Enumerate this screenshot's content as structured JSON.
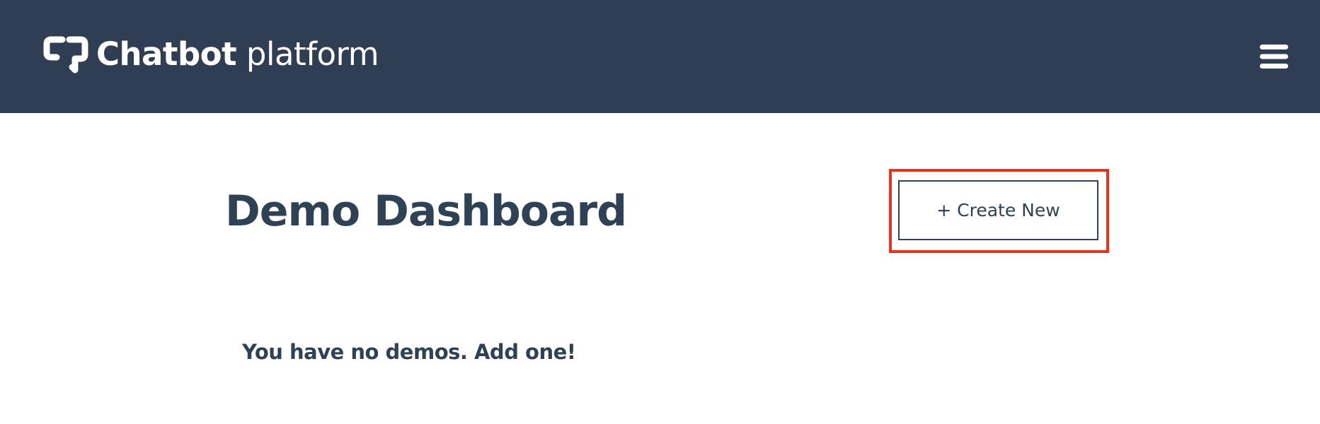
{
  "header": {
    "brand_bold": "Chatbot",
    "brand_light": "platform",
    "logo_icon": "chat-bubble-logo-icon",
    "menu_icon": "hamburger-menu-icon",
    "background_color": "#2f3e52"
  },
  "main": {
    "title": "Demo Dashboard",
    "create_button_label": "+ Create New",
    "empty_message": "You have no demos. Add one!",
    "text_color": "#2f4155",
    "highlight_color": "#e8321b"
  }
}
